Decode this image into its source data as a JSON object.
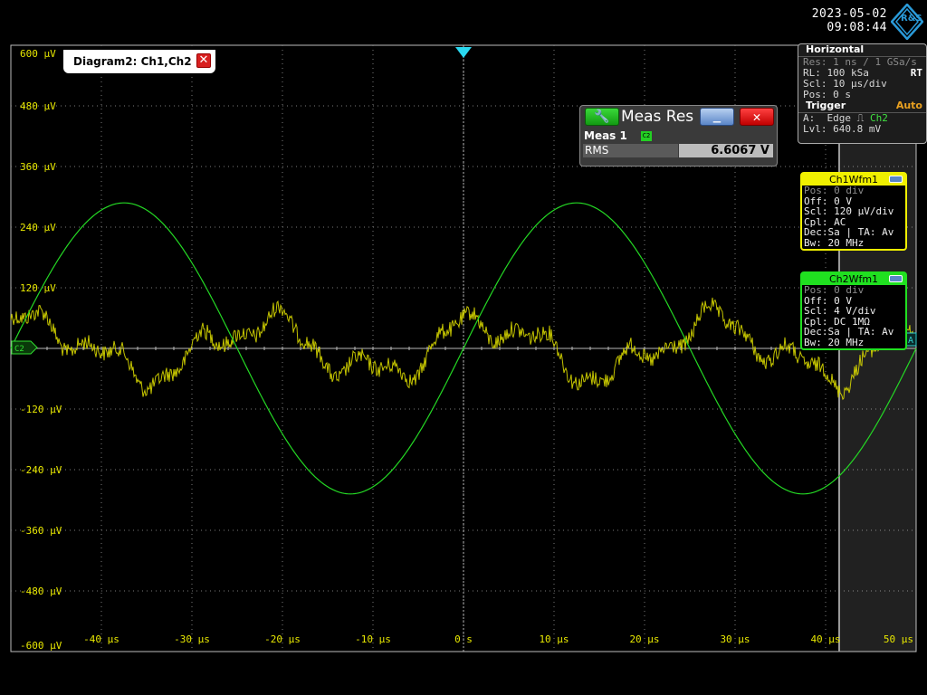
{
  "datetime": {
    "date": "2023-05-02",
    "time": "09:08:44"
  },
  "logo": {
    "letters": "R&S"
  },
  "diagram_tab": {
    "title": "Diagram2: Ch1,Ch2"
  },
  "meas_dialog": {
    "title": "Meas Res",
    "meas_name": "Meas 1",
    "channel_tag": "C2",
    "row_label": "RMS",
    "row_value": "6.6067 V"
  },
  "horizontal": {
    "title": "Horizontal",
    "res": "Res: 1 ns / 1 GSa/s",
    "rl_label": "RL:",
    "rl_value": "100 kSa",
    "rt": "RT",
    "scl_label": "Scl:",
    "scl_value": "10 µs/div",
    "pos_label": "Pos:",
    "pos_value": "0 s",
    "trigger_title": "Trigger",
    "trigger_mode": "Auto",
    "a_label": "A:",
    "a_value": "Edge",
    "a_source": "Ch2",
    "lvl_label": "Lvl:",
    "lvl_value": "640.8 mV"
  },
  "ch1": {
    "title": "Ch1Wfm1",
    "color": "#f0f000",
    "lines": [
      "Pos: 0 div",
      "Off: 0 V",
      "Scl: 120 µV/div",
      "Cpl: AC",
      "Dec:Sa | TA: Av",
      "Bw: 20 MHz"
    ]
  },
  "ch2": {
    "title": "Ch2Wfm1",
    "color": "#20e020",
    "lines": [
      "Pos: 0 div",
      "Off: 0 V",
      "Scl: 4 V/div",
      "Cpl: DC 1MΩ",
      "Dec:Sa | TA: Av",
      "Bw: 20 MHz"
    ]
  },
  "markers": {
    "ch2_level": "C2",
    "ref_right": "A"
  },
  "chart_data": {
    "type": "line",
    "x_unit": "µs",
    "xlim": [
      -50,
      50
    ],
    "ylim": [
      -600,
      600
    ],
    "y_unit": "µV",
    "x_ticks": [
      "-40 µs",
      "-30 µs",
      "-20 µs",
      "-10 µs",
      "0 s",
      "10 µs",
      "20 µs",
      "30 µs",
      "40 µs",
      "50 µs"
    ],
    "y_ticks": [
      "600 µV",
      "480 µV",
      "360 µV",
      "240 µV",
      "120 µV",
      "",
      "-120 µV",
      "-240 µV",
      "-360 µV",
      "-480 µV",
      "-600 µV"
    ],
    "grid": true,
    "series": [
      {
        "color": "#f0f000",
        "kind": "noise"
      },
      {
        "color": "#20e020",
        "kind": "sine",
        "period": 50,
        "amplitude_div": 2.4,
        "phase_zero_us": 0
      }
    ],
    "highlight_region_x": [
      41.5,
      50
    ]
  }
}
